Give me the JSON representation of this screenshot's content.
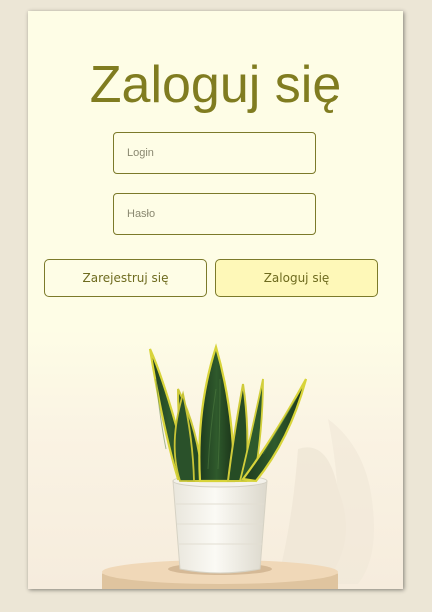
{
  "page": {
    "title": "Zaloguj się"
  },
  "form": {
    "login_placeholder": "Login",
    "password_placeholder": "Hasło",
    "register_label": "Zarejestruj się",
    "login_label": "Zaloguj się"
  },
  "colors": {
    "background": "#ece6d6",
    "card": "#fefde6",
    "accent": "#807c20",
    "login_button": "#fef8b8"
  },
  "images": {
    "hero": "snake-plant-in-white-pot"
  }
}
